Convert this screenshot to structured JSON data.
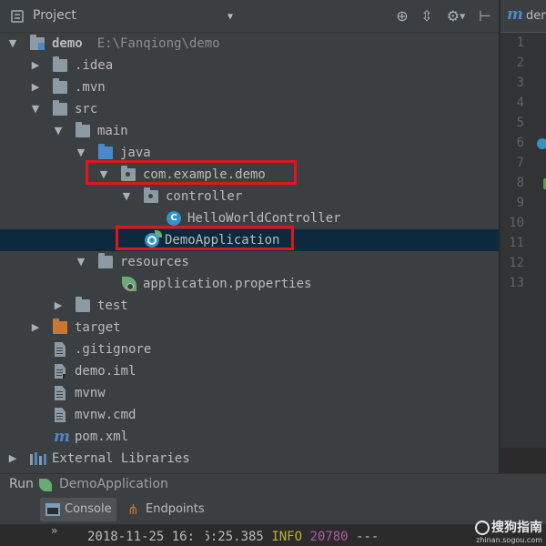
{
  "panel": {
    "title": "Project",
    "tools": [
      {
        "name": "locate",
        "glyph": "⊕"
      },
      {
        "name": "collapse",
        "glyph": "⇳"
      },
      {
        "name": "settings",
        "glyph": "⚙"
      },
      {
        "name": "hide",
        "glyph": "⊢"
      }
    ]
  },
  "tree": {
    "root": {
      "label": "demo",
      "path": "E:\\Fanqiong\\demo"
    },
    "items": [
      {
        "label": ".idea"
      },
      {
        "label": ".mvn"
      },
      {
        "label": "src"
      },
      {
        "label": "main"
      },
      {
        "label": "java"
      },
      {
        "label": "com.example.demo"
      },
      {
        "label": "controller"
      },
      {
        "label": "HelloWorldController"
      },
      {
        "label": "DemoApplication"
      },
      {
        "label": "resources"
      },
      {
        "label": "application.properties"
      },
      {
        "label": "test"
      },
      {
        "label": "target"
      },
      {
        "label": ".gitignore"
      },
      {
        "label": "demo.iml"
      },
      {
        "label": "mvnw"
      },
      {
        "label": "mvnw.cmd"
      },
      {
        "label": "pom.xml"
      },
      {
        "label": "External Libraries"
      }
    ]
  },
  "editor": {
    "tab_label": "demo",
    "line_numbers": [
      "1",
      "2",
      "3",
      "4",
      "5",
      "6",
      "7",
      "8",
      "9",
      "10",
      "11",
      "12",
      "13"
    ]
  },
  "run": {
    "label": "Run",
    "app": "DemoApplication",
    "tabs": [
      "Console",
      "Endpoints"
    ],
    "console_text_date": "2018-11-25 16:16:25.385",
    "console_level": "INFO",
    "console_pid": "20780",
    "console_tail": "---"
  },
  "watermark": {
    "brand": "搜狗指南",
    "url": "zhinan.sogou.com"
  },
  "colors": {
    "highlight": "#e0161b",
    "selection": "#0d293e",
    "panel_bg": "#3c3f41",
    "editor_bg": "#2b2b2b"
  }
}
